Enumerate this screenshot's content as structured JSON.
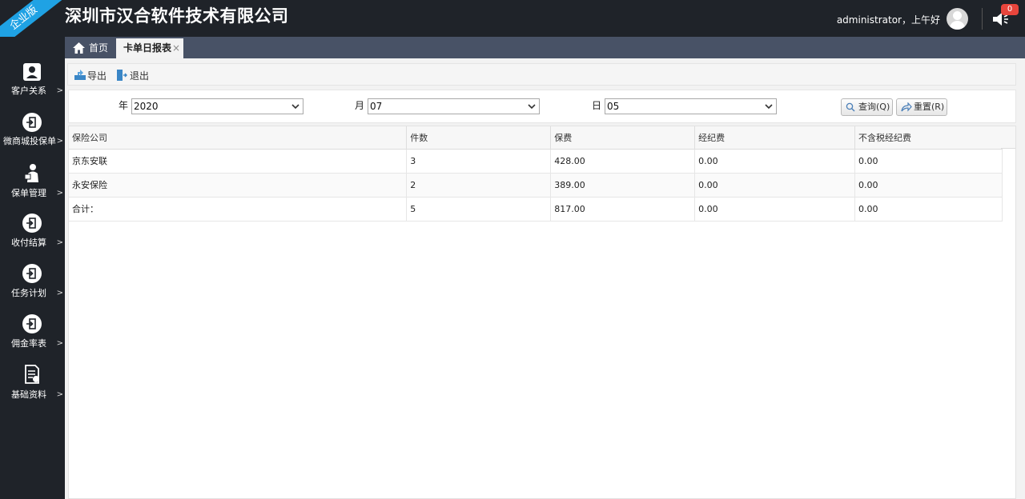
{
  "header": {
    "edition_ribbon": "企业版",
    "company_title": "深圳市汉合软件技术有限公司",
    "user_greeting": "administrator，上午好",
    "notification_count": "0"
  },
  "sidebar": {
    "items": [
      {
        "label": "客户关系",
        "icon": "user-card-icon"
      },
      {
        "label": "微商城投保单",
        "icon": "logout-circle-icon"
      },
      {
        "label": "保单管理",
        "icon": "agent-person-icon"
      },
      {
        "label": "收付结算",
        "icon": "logout-circle-icon"
      },
      {
        "label": "任务计划",
        "icon": "logout-circle-icon"
      },
      {
        "label": "佣金率表",
        "icon": "logout-circle-icon"
      },
      {
        "label": "基础资料",
        "icon": "document-icon"
      }
    ],
    "arrow": ">"
  },
  "tabs": {
    "home": "首页",
    "report": "卡单日报表",
    "close": "×"
  },
  "toolbar": {
    "export": "导出",
    "exit": "退出"
  },
  "filters": {
    "year_label": "年",
    "year_value": "2020",
    "month_label": "月",
    "month_value": "07",
    "day_label": "日",
    "day_value": "05",
    "query": "查询(Q)",
    "reset": "重置(R)"
  },
  "table": {
    "columns": [
      "保险公司",
      "件数",
      "保费",
      "经纪费",
      "不含税经纪费"
    ],
    "rows": [
      [
        "京东安联",
        "3",
        "428.00",
        "0.00",
        "0.00"
      ],
      [
        "永安保险",
        "2",
        "389.00",
        "0.00",
        "0.00"
      ],
      [
        "合计：",
        "5",
        "817.00",
        "0.00",
        "0.00"
      ]
    ]
  }
}
